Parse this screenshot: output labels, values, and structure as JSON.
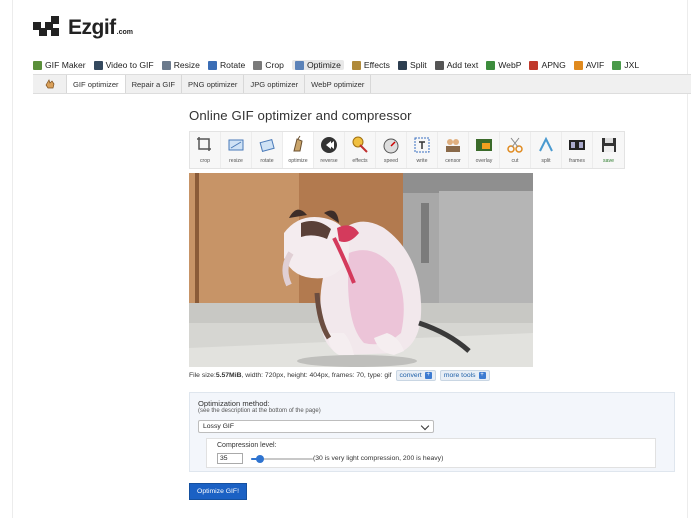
{
  "logo": {
    "text": "Ezgif",
    "suffix": ".com"
  },
  "main_nav": [
    {
      "label": "GIF Maker",
      "icon": "gif-maker-icon",
      "color": "#5a8f3a"
    },
    {
      "label": "Video to GIF",
      "icon": "video-icon",
      "color": "#34495e"
    },
    {
      "label": "Resize",
      "icon": "resize-icon",
      "color": "#6b7a8c"
    },
    {
      "label": "Rotate",
      "icon": "rotate-icon",
      "color": "#3b6db5"
    },
    {
      "label": "Crop",
      "icon": "crop-icon",
      "color": "#7a7a7a"
    },
    {
      "label": "Optimize",
      "icon": "optimize-icon",
      "color": "#5b82b8",
      "active": true
    },
    {
      "label": "Effects",
      "icon": "effects-icon",
      "color": "#b08a3a"
    },
    {
      "label": "Split",
      "icon": "split-icon",
      "color": "#2d3e50"
    },
    {
      "label": "Add text",
      "icon": "text-icon",
      "color": "#555555"
    },
    {
      "label": "WebP",
      "icon": "webp-icon",
      "color": "#3c8c3c"
    },
    {
      "label": "APNG",
      "icon": "apng-icon",
      "color": "#c0392b"
    },
    {
      "label": "AVIF",
      "icon": "avif-icon",
      "color": "#e08a1e"
    },
    {
      "label": "JXL",
      "icon": "jxl-icon",
      "color": "#4a9a4a"
    }
  ],
  "sub_nav": [
    {
      "label": "GIF optimizer",
      "active": true
    },
    {
      "label": "Repair a GIF"
    },
    {
      "label": "PNG optimizer"
    },
    {
      "label": "JPG optimizer"
    },
    {
      "label": "WebP optimizer"
    }
  ],
  "page_title": "Online GIF optimizer and compressor",
  "tools": [
    {
      "label": "crop",
      "icon": "crop-tool-icon"
    },
    {
      "label": "resize",
      "icon": "resize-tool-icon"
    },
    {
      "label": "rotate",
      "icon": "rotate-tool-icon"
    },
    {
      "label": "optimize",
      "icon": "optimize-tool-icon",
      "active": true
    },
    {
      "label": "reverse",
      "icon": "reverse-tool-icon"
    },
    {
      "label": "effects",
      "icon": "effects-tool-icon"
    },
    {
      "label": "speed",
      "icon": "speed-tool-icon"
    },
    {
      "label": "write",
      "icon": "write-tool-icon"
    },
    {
      "label": "censor",
      "icon": "censor-tool-icon"
    },
    {
      "label": "overlay",
      "icon": "overlay-tool-icon"
    },
    {
      "label": "cut",
      "icon": "cut-tool-icon"
    },
    {
      "label": "split",
      "icon": "split-tool-icon"
    },
    {
      "label": "frames",
      "icon": "frames-tool-icon"
    },
    {
      "label": "save",
      "icon": "save-tool-icon"
    }
  ],
  "file_info": {
    "prefix": "File size: ",
    "size": "5.57MiB",
    "details": ", width: 720px, height: 404px, frames: 70, type: gif",
    "convert_label": "convert",
    "more_tools_label": "more tools"
  },
  "options": {
    "method_label": "Optimization method:",
    "method_hint": "(see the description at the bottom of the page)",
    "method_value": "Lossy GIF",
    "compression_label": "Compression level:",
    "compression_value": "35",
    "compression_fraction": 0.14,
    "compression_hint": "(30 is very light compression, 200 is heavy)"
  },
  "submit_label": "Optimize GIF!"
}
